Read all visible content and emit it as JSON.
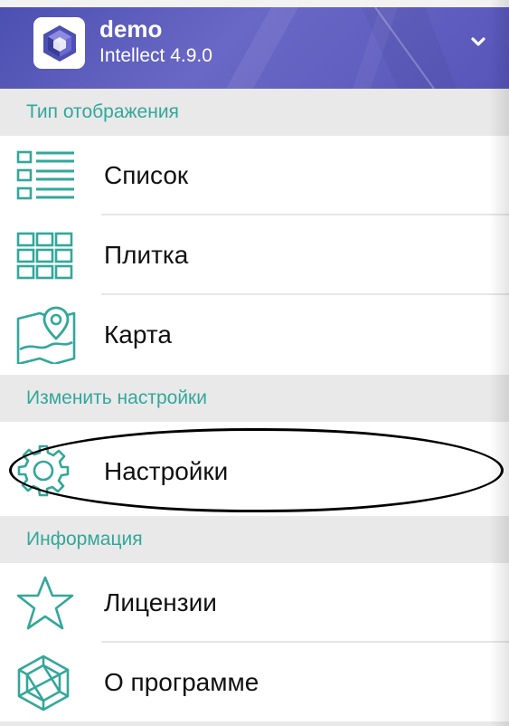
{
  "header": {
    "app_name": "demo",
    "app_version": "Intellect 4.9.0",
    "logo_icon": "cube-logo-icon",
    "expand_icon": "chevron-down-icon"
  },
  "sections": [
    {
      "title": "Тип отображения",
      "items": [
        {
          "label": "Список",
          "icon": "list-view-icon"
        },
        {
          "label": "Плитка",
          "icon": "tile-grid-icon"
        },
        {
          "label": "Карта",
          "icon": "map-pin-icon"
        }
      ]
    },
    {
      "title": "Изменить настройки",
      "items": [
        {
          "label": "Настройки",
          "icon": "gear-icon"
        }
      ]
    },
    {
      "title": "Информация",
      "items": [
        {
          "label": "Лицензии",
          "icon": "star-icon"
        },
        {
          "label": "О программе",
          "icon": "cube-about-icon"
        }
      ]
    }
  ],
  "colors": {
    "accent": "#33a79a",
    "header": "#5a58bb",
    "section_bg": "#e9e9e9"
  }
}
